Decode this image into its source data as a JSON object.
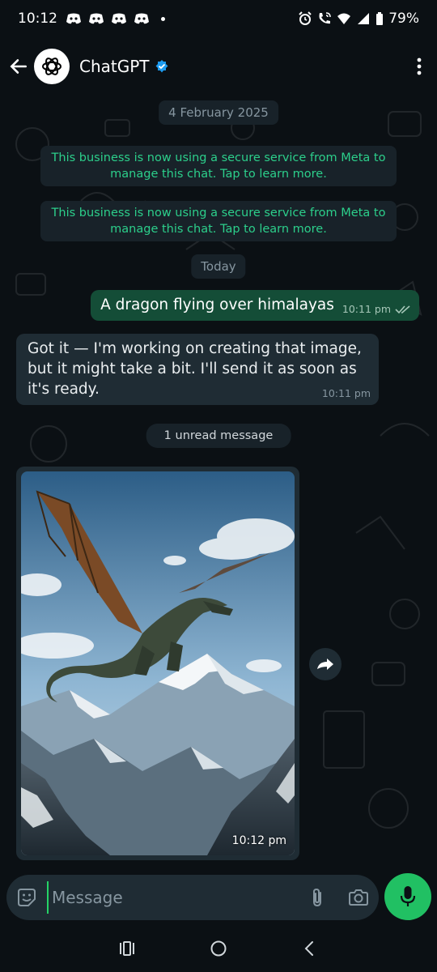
{
  "status_bar": {
    "time": "10:12",
    "battery": "79%",
    "notification_icons": [
      "discord-icon",
      "discord-icon",
      "discord-icon",
      "discord-icon"
    ],
    "right_icons": [
      "alarm-icon",
      "wifi-calling-icon",
      "wifi-icon",
      "signal-icon",
      "battery-icon"
    ]
  },
  "header": {
    "contact_name": "ChatGPT",
    "verified": true,
    "avatar_icon": "openai-logo-icon"
  },
  "chat": {
    "date_chip": "4 February 2025",
    "system_messages": [
      "This business is now using a secure service from Meta to manage this chat. Tap to learn more.",
      "This business is now using a secure service from Meta to manage this chat. Tap to learn more."
    ],
    "today_chip": "Today",
    "outgoing": {
      "text": "A dragon flying over himalayas",
      "time": "10:11 pm",
      "status": "read"
    },
    "incoming": {
      "text": "Got it — I'm working on creating that image, but it might take a bit. I'll send it as soon as it's ready.",
      "time": "10:11 pm"
    },
    "unread_chip": "1 unread message",
    "image_message": {
      "time": "10:12 pm"
    }
  },
  "input": {
    "placeholder": "Message"
  },
  "colors": {
    "background": "#0b1014",
    "outgoing_bubble": "#144d37",
    "incoming_bubble": "#1f2c34",
    "system_text": "#2ccf8b",
    "accent": "#21c063",
    "verified": "#1d9bf0"
  }
}
